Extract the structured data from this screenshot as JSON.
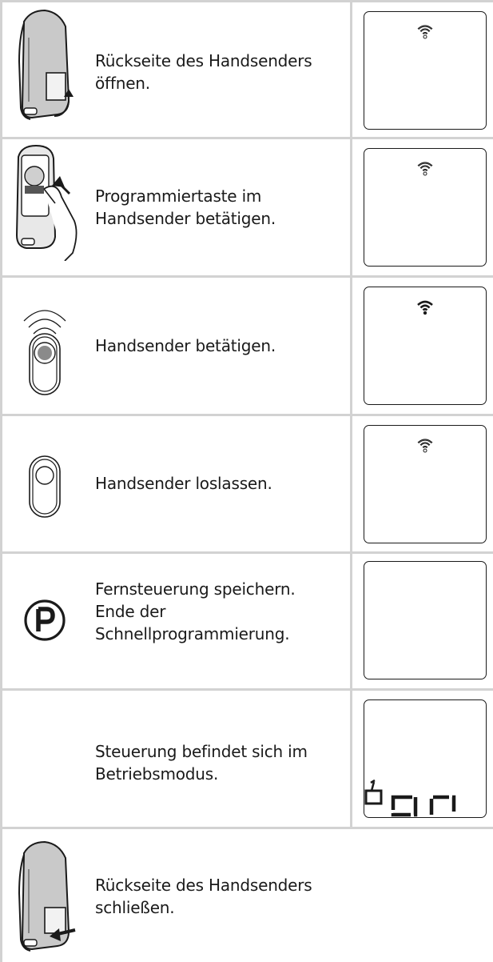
{
  "steps": [
    {
      "lines": [
        "Rückseite des Handsenders",
        "öffnen."
      ],
      "icon": "remote-open-back-icon",
      "display": "signal-outline"
    },
    {
      "lines": [
        "Programmiertaste im",
        "Handsender betätigen."
      ],
      "icon": "remote-program-button-icon",
      "display": "signal-outline"
    },
    {
      "lines": [
        "Handsender betätigen."
      ],
      "icon": "remote-button-press-icon",
      "display": "signal-filled"
    },
    {
      "lines": [
        "Handsender loslassen."
      ],
      "icon": "remote-button-release-icon",
      "display": "signal-outline"
    },
    {
      "lines": [
        "Fernsteuerung speichern.",
        "Ende der",
        "Schnellprogrammierung."
      ],
      "icon": "program-p-icon",
      "display": "blank"
    },
    {
      "lines": [
        "Steuerung befindet sich im",
        "Betriebsmodus."
      ],
      "icon": "",
      "display": "on-indicator"
    },
    {
      "lines": [
        "Rückseite des Handsenders",
        "schließen."
      ],
      "icon": "remote-close-back-icon",
      "display": "none"
    }
  ],
  "colors": {
    "grid": "#d2d2d2",
    "ink": "#1a1a1a"
  }
}
